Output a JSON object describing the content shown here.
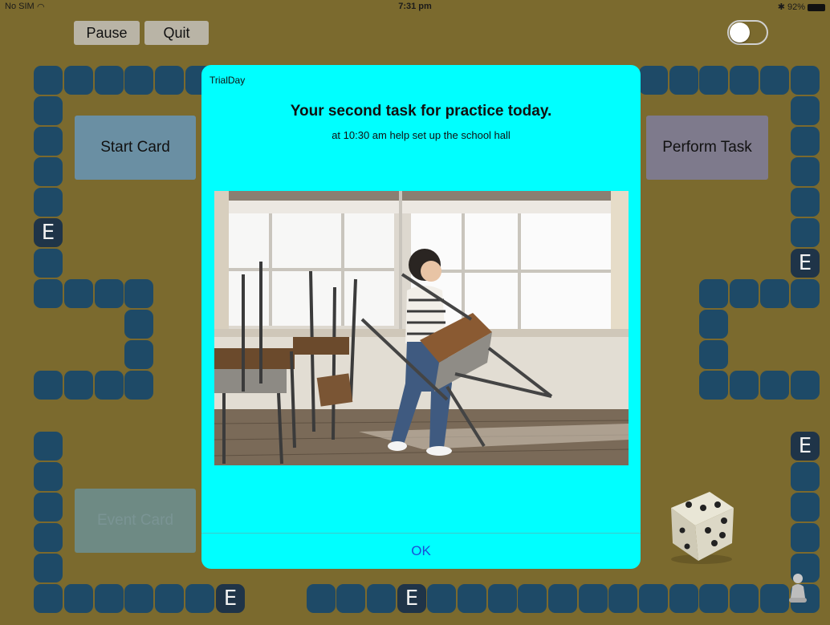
{
  "status_bar": {
    "carrier": "No SIM",
    "time": "7:31 pm",
    "battery": "92%"
  },
  "toolbar": {
    "pause_label": "Pause",
    "quit_label": "Quit"
  },
  "board": {
    "event_tile_label": "E",
    "cards": {
      "start": "Start Card",
      "perform": "Perform Task",
      "event": "Event Card"
    }
  },
  "dialog": {
    "app_name": "TrialDay",
    "title": "Your second task for practice today.",
    "message": "at 10:30 am help set up the school hall",
    "ok_label": "OK"
  },
  "colors": {
    "board_bg": "#7b6a2e",
    "tile": "#1e4a67",
    "dialog_bg": "#00ffff",
    "ok_text": "#1a4fd8"
  }
}
